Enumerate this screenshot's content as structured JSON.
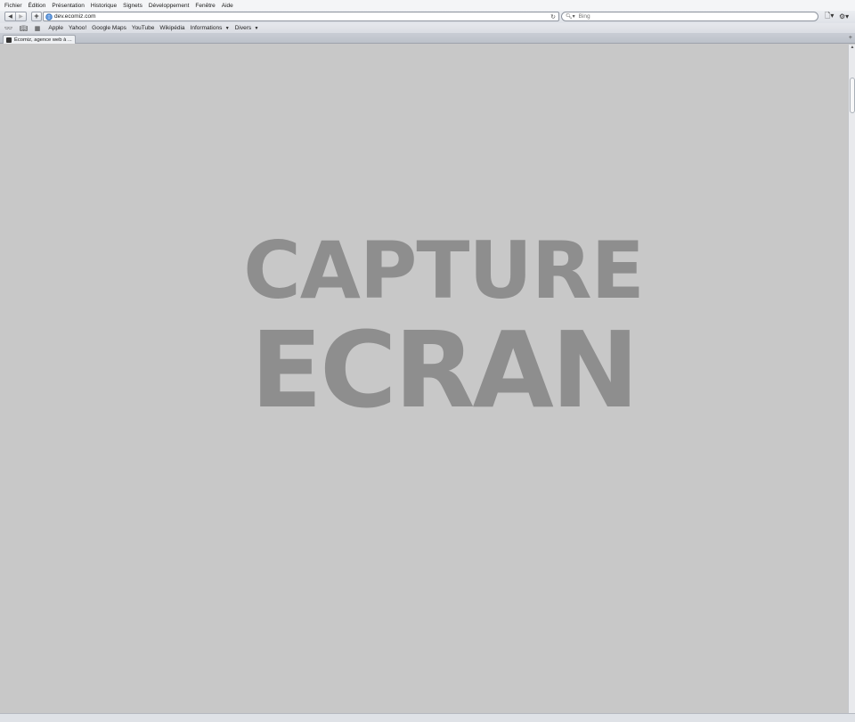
{
  "menu": {
    "items": [
      "Fichier",
      "Édition",
      "Présentation",
      "Historique",
      "Signets",
      "Développement",
      "Fenêtre",
      "Aide"
    ]
  },
  "toolbar": {
    "back_icon": "back-arrow-icon",
    "forward_icon": "forward-arrow-icon",
    "add_icon": "plus-icon",
    "url": "dev.ecomiz.com",
    "search_placeholder": "Bing"
  },
  "bookmarks": {
    "items": [
      "Apple",
      "Yahoo!",
      "Google Maps",
      "YouTube",
      "Wikipédia",
      "Informations",
      "Divers"
    ]
  },
  "tab": {
    "title": "Écomiz, agence web à ..."
  },
  "content": {
    "line1": "CAPTURE",
    "line2": "ECRAN",
    "text_color": "#8e8e8e",
    "background_color": "#c8c8c8"
  }
}
